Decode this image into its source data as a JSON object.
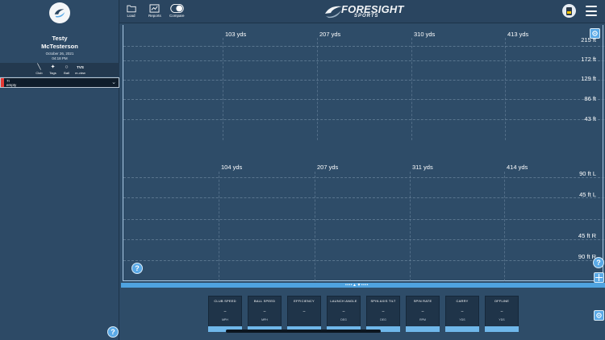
{
  "user": {
    "first_name": "Testy",
    "last_name": "McTesterson",
    "date": "October 26, 2021",
    "time": "04:18 PM"
  },
  "sidebar": {
    "tabs": [
      {
        "label": "Club",
        "icon": "club-icon"
      },
      {
        "label": "Tags",
        "icon": "tag-icon"
      },
      {
        "label": "Ball",
        "icon": "ball-icon"
      },
      {
        "label": "m-view",
        "icon": "tvs-icon",
        "icon_text": "TVS"
      }
    ],
    "session": {
      "line1": "7I",
      "line2": "empty",
      "flag_color": "#e53935"
    }
  },
  "toolbar": {
    "load_label": "Load",
    "reports_label": "Reports",
    "compare_label": "Compare"
  },
  "brand": {
    "main": "FORESIGHT",
    "sub": "SPORTS"
  },
  "top_view": {
    "distance_labels": [
      "103 yds",
      "207 yds",
      "310 yds",
      "413 yds"
    ],
    "height_labels": [
      "215 ft",
      "172 ft",
      "129 ft",
      "86 ft",
      "43 ft"
    ]
  },
  "side_view": {
    "distance_labels": [
      "104 yds",
      "207 yds",
      "311 yds",
      "414 yds"
    ],
    "offline_labels": [
      "90 ft L",
      "45 ft L",
      "45 ft R",
      "90 ft R"
    ]
  },
  "help_label": "?",
  "data_tiles": [
    {
      "header": "CLUB SPEED",
      "value": "–",
      "unit": "MPH"
    },
    {
      "header": "BALL SPEED",
      "value": "–",
      "unit": "MPH"
    },
    {
      "header": "EFFICIENCY",
      "value": "–",
      "unit": ""
    },
    {
      "header": "LAUNCH ANGLE",
      "value": "–",
      "unit": "DEG"
    },
    {
      "header": "SPIN AXIS TILT",
      "value": "–",
      "unit": "DEG"
    },
    {
      "header": "SPIN RATE",
      "value": "–",
      "unit": "RPM"
    },
    {
      "header": "CARRY",
      "value": "–",
      "unit": "YDS"
    },
    {
      "header": "OFFLINE",
      "value": "–",
      "unit": "YDS"
    }
  ],
  "colors": {
    "accent": "#5aa9e6",
    "background": "#2e4c68",
    "tile": "#1f3449",
    "flag": "#e53935"
  }
}
